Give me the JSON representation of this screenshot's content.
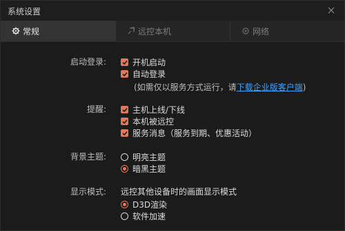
{
  "window": {
    "title": "系统设置"
  },
  "tabs": [
    {
      "label": "常规",
      "icon": "gear-icon",
      "active": true
    },
    {
      "label": "远控本机",
      "icon": "remote-icon",
      "active": false
    },
    {
      "label": "网络",
      "icon": "network-icon",
      "active": false
    }
  ],
  "startup": {
    "label": "启动登录:",
    "boot_start": "开机启动",
    "auto_login": "自动登录",
    "note_prefix": "(如需仅以服务方式运行，请",
    "note_link": "下载企业版客户端",
    "note_suffix": ")"
  },
  "reminder": {
    "label": "提醒:",
    "opt1": "主机上线/下线",
    "opt2": "本机被远控",
    "opt3": "服务消息（服务到期、优惠活动）"
  },
  "theme": {
    "label": "背景主题:",
    "light": "明亮主题",
    "dark": "暗黑主题",
    "selected": "dark"
  },
  "display": {
    "label": "显示模式:",
    "desc": "远控其他设备时的画面显示模式",
    "d3d": "D3D渲染",
    "software": "软件加速",
    "selected": "d3d"
  },
  "colors": {
    "accent": "#e0795a",
    "link": "#3ea2ff",
    "background": "#1b1b1b"
  }
}
